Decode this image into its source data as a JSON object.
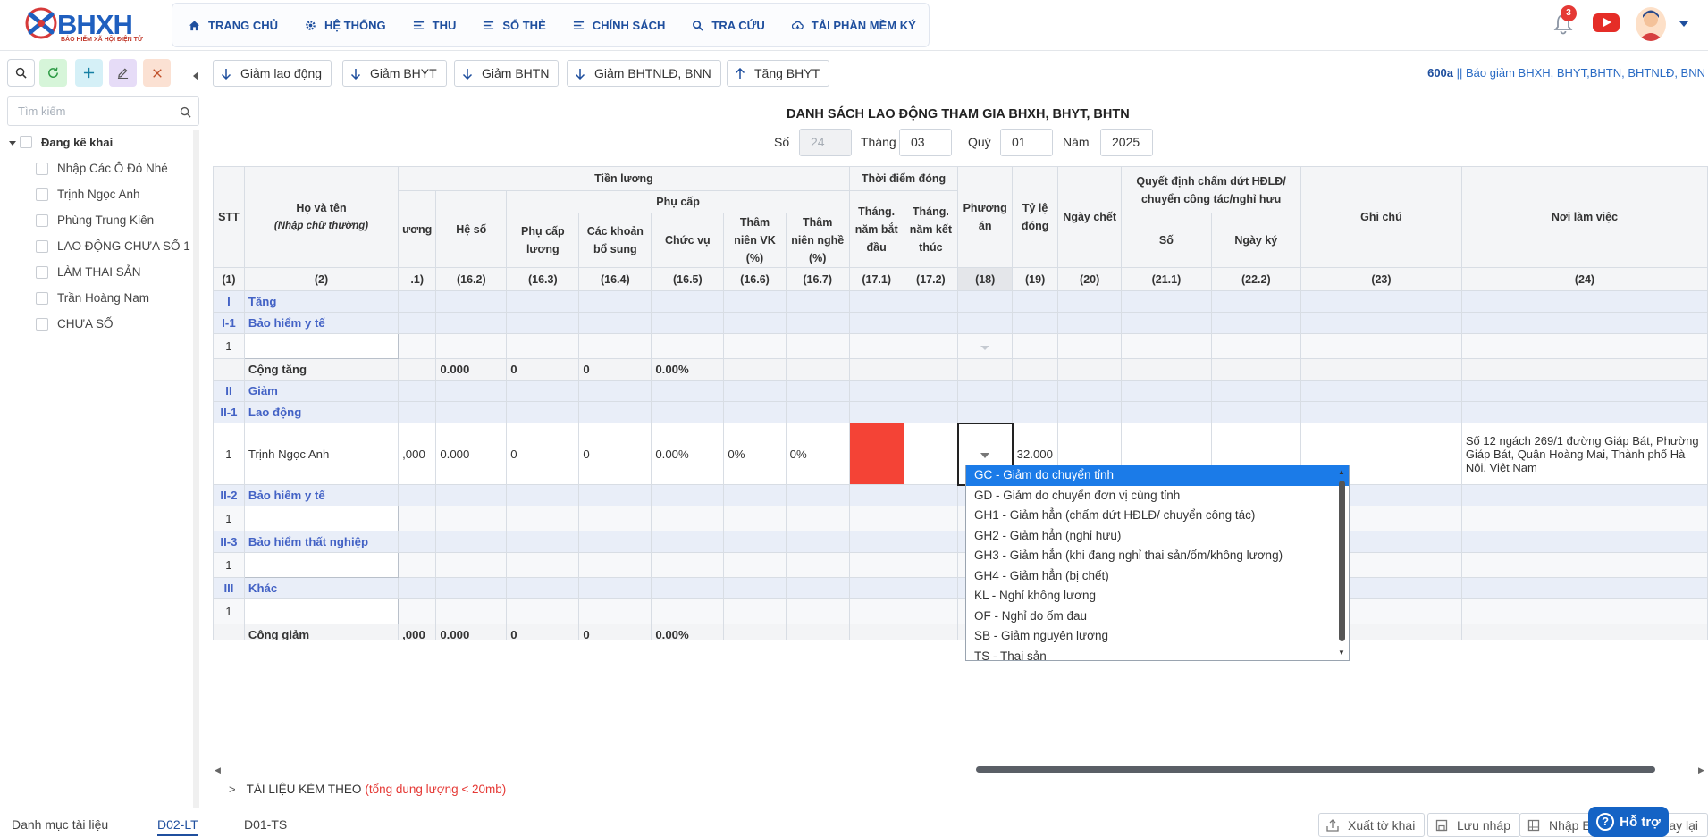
{
  "brand": {
    "name": "BHXH",
    "subtitle": "BẢO HIỂM XÃ HỘI ĐIỆN TỬ"
  },
  "nav": [
    {
      "label": "TRANG CHỦ",
      "icon": "home-icon"
    },
    {
      "label": "HỆ THỐNG",
      "icon": "gear-icon"
    },
    {
      "label": "THU",
      "icon": "list-icon"
    },
    {
      "label": "SỔ THẺ",
      "icon": "list-icon"
    },
    {
      "label": "CHÍNH SÁCH",
      "icon": "list-icon"
    },
    {
      "label": "TRA CỨU",
      "icon": "search-icon"
    },
    {
      "label": "TẢI PHẦN MỀM KÝ",
      "icon": "cloud-icon"
    }
  ],
  "notifications": {
    "count": "3"
  },
  "sidebar": {
    "search_placeholder": "Tìm kiếm",
    "root": "Đang kê khai",
    "items": [
      "Nhập Các Ô Đỏ Nhé",
      "Trịnh Ngọc Anh",
      "Phùng Trung Kiên",
      "LAO ĐỘNG CHƯA SỐ 1",
      "LÀM THAI SẢN",
      "Trần Hoàng Nam",
      "CHƯA SỐ"
    ]
  },
  "actions": [
    "Giảm lao động",
    "Giảm BHYT",
    "Giảm BHTN",
    "Giảm BHTNLĐ, BNN",
    "Tăng BHYT"
  ],
  "form_code": {
    "code": "600a",
    "desc": " || Báo giảm BHXH, BHYT,BHTN, BHTNLĐ, BNN"
  },
  "form": {
    "title": "DANH SÁCH LAO ĐỘNG THAM GIA BHXH, BHYT, BHTN",
    "so_label": "Số",
    "so_value": "24",
    "thang_label": "Tháng",
    "thang_value": "03",
    "quy_label": "Quý",
    "quy_value": "01",
    "nam_label": "Năm",
    "nam_value": "2025"
  },
  "table": {
    "headers": {
      "stt": "STT",
      "hoten": "Họ và tên",
      "hoten_note": "(Nhập chữ thường)",
      "tienluong": "Tiền lương",
      "muc_luong": "ương",
      "he_so": "Hệ số",
      "phu_cap": "Phụ cấp",
      "phu_cap_luong": "Phụ cấp lương",
      "cac_khoan_bo_sung": "Các khoản bổ sung",
      "chuc_vu": "Chức vụ",
      "tham_nien_vk": "Thâm niên VK (%)",
      "tham_nien_nghe": "Thâm niên nghề (%)",
      "thoi_diem_dong": "Thời điểm đóng",
      "thang_bat_dau": "Tháng. năm bắt đầu",
      "thang_ket_thuc": "Tháng. năm kết thúc",
      "phuong_an": "Phương án",
      "ty_le_dong": "Tỷ lệ đóng",
      "ngay_chet": "Ngày chết",
      "quyet_dinh": "Quyết định chấm dứt HĐLĐ/ chuyển công tác/nghỉ hưu",
      "qd_so": "Số",
      "qd_ngay_ky": "Ngày ký",
      "ghi_chu": "Ghi chú",
      "noi_lam_viec": "Nơi làm việc"
    },
    "col_numbers": [
      "(1)",
      "(2)",
      ".1)",
      "(16.2)",
      "(16.3)",
      "(16.4)",
      "(16.5)",
      "(16.6)",
      "(16.7)",
      "(17.1)",
      "(17.2)",
      "(18)",
      "(19)",
      "(20)",
      "(21.1)",
      "(22.2)",
      "(23)",
      "(24)"
    ],
    "rows": {
      "r1": {
        "stt": "I",
        "label": "Tăng"
      },
      "r2": {
        "stt": "I-1",
        "label": "Bảo hiểm y tế"
      },
      "r3": {
        "stt": "1"
      },
      "r4": {
        "label": "Cộng tăng",
        "he_so": "0.000",
        "pc_luong": "0",
        "bo_sung": "0",
        "chuc_vu": "0.00%"
      },
      "r5": {
        "stt": "II",
        "label": "Giảm"
      },
      "r6": {
        "stt": "II-1",
        "label": "Lao động"
      },
      "r7": {
        "stt": "1",
        "name": "Trịnh Ngọc Anh",
        "muc_luong": ",000",
        "he_so": "0.000",
        "pc_luong": "0",
        "bo_sung": "0",
        "chuc_vu": "0.00%",
        "tn_vk": "0%",
        "tn_nghe": "0%",
        "ty_le": "32.000",
        "noi_lam_viec": "Số 12 ngách 269/1 đường Giáp Bát, Phường Giáp Bát, Quận Hoàng Mai, Thành phố Hà Nội, Việt Nam"
      },
      "r8": {
        "stt": "II-2",
        "label": "Bảo hiểm y tế"
      },
      "r9": {
        "stt": "1"
      },
      "r10": {
        "stt": "II-3",
        "label": "Bảo hiểm thất nghiệp"
      },
      "r11": {
        "stt": "1"
      },
      "r12": {
        "stt": "III",
        "label": "Khác"
      },
      "r13": {
        "stt": "1"
      },
      "r14": {
        "label": "Cộng giảm",
        "muc_luong": ",000",
        "he_so": "0.000",
        "pc_luong": "0",
        "bo_sung": "0",
        "chuc_vu": "0.00%"
      }
    }
  },
  "dropdown": {
    "options": [
      "GC - Giảm do chuyển tỉnh",
      "GD - Giảm do chuyển đơn vị cùng tỉnh",
      "GH1 - Giảm hẳn (chấm dứt HĐLĐ/ chuyển công tác)",
      "GH2 - Giảm hẳn (nghỉ hưu)",
      "GH3 - Giảm hẳn (khi đang nghỉ thai sản/ốm/không lương)",
      "GH4 - Giảm hẳn (bị chết)",
      "KL - Nghỉ không lương",
      "OF - Nghỉ do ốm đau",
      "SB - Giảm nguyên lương",
      "TS - Thai sản"
    ],
    "selected": "GC - Giảm do chuyển tỉnh"
  },
  "attachments": {
    "label": "TÀI LIỆU KÈM THEO",
    "note": "(tổng dung lượng < 20mb)"
  },
  "footer": {
    "tabs": [
      "Danh mục tài liệu",
      "D02-LT",
      "D01-TS"
    ],
    "active_tab": "D02-LT",
    "buttons": [
      "Xuất tờ khai",
      "Lưu nháp",
      "Nhập E",
      "ay lại"
    ],
    "help": "Hỗ trợ"
  },
  "colors": {
    "primary": "#1f4f9e",
    "band": "#e9eef8",
    "band_text": "#4362c5",
    "required_cell": "#f44336",
    "selected_option": "#1b7be8",
    "help_button": "#1463c5"
  }
}
